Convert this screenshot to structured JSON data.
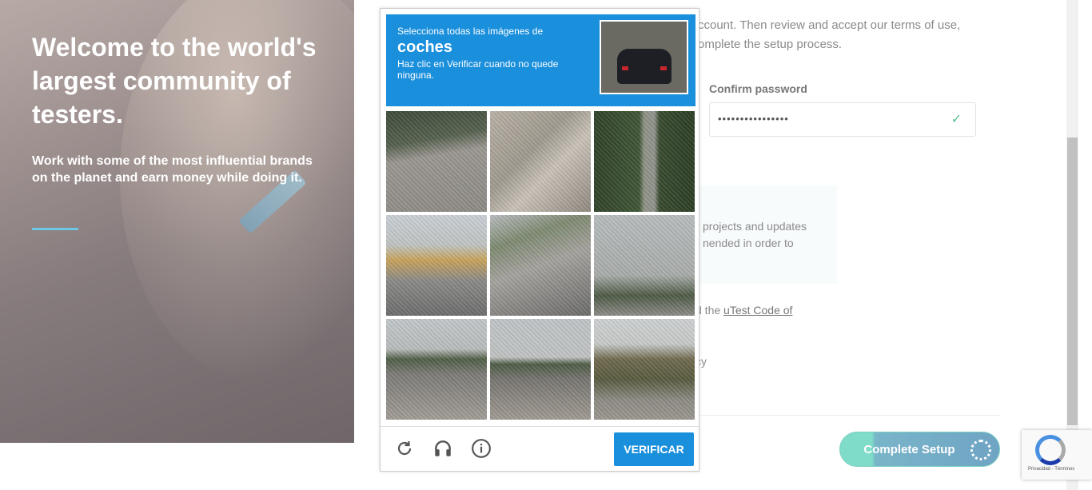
{
  "hero": {
    "title": "Welcome to the world's largest community of testers.",
    "subtitle": "Work with some of the most influential brands on the planet and earn money while doing it."
  },
  "form": {
    "intro_line1": "ccount. Then review and accept our terms of use,",
    "intro_line2": "omplete the setup process.",
    "confirm_password_label": "Confirm password",
    "confirm_password_value": "••••••••••••••••",
    "notice_line1": "projects and updates",
    "notice_line2": "nended in order to",
    "code_prefix": "d the ",
    "code_link": "uTest Code of",
    "policy_fragment": "cy",
    "complete_button": "Complete Setup"
  },
  "captcha": {
    "line1": "Selecciona todas las imágenes de",
    "keyword": "coches",
    "line2": "Haz clic en Verificar cuando no quede ninguna.",
    "verify_button": "VERIFICAR",
    "tile_count": 9
  },
  "recaptcha_badge": {
    "terms": "Privacidad - Términos"
  },
  "colors": {
    "captcha_blue": "#1a8fdc",
    "setup_green": "#7fdcc9",
    "setup_blue": "#6fa4c4"
  }
}
